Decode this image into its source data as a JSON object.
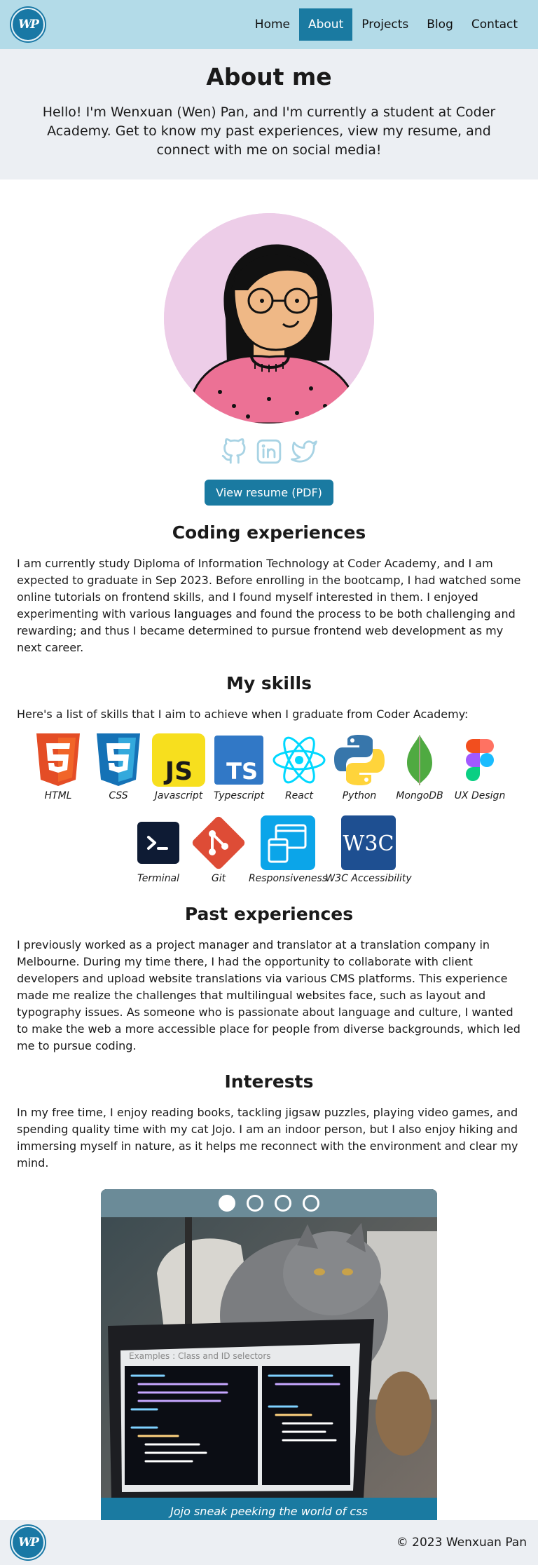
{
  "nav": {
    "logo_text": "WP",
    "links": [
      "Home",
      "About",
      "Projects",
      "Blog",
      "Contact"
    ],
    "active": "About"
  },
  "hero": {
    "title": "About me",
    "intro": "Hello! I'm Wenxuan (Wen) Pan, and I'm currently a student at Coder Academy. Get to know my past experiences, view my resume, and connect with me on social media!"
  },
  "socials": [
    "github-icon",
    "linkedin-icon",
    "twitter-icon"
  ],
  "resume_button": "View resume (PDF)",
  "coding": {
    "heading": "Coding experiences",
    "text": "I am currently study Diploma of Information Technology at Coder Academy, and I am expected to graduate in Sep 2023. Before enrolling in the bootcamp, I had watched some online tutorials on frontend skills, and I found myself interested in them. I enjoyed experimenting with various languages and found the process to be both challenging and rewarding; and thus I became determined to pursue frontend web development as my next career."
  },
  "skills": {
    "heading": "My skills",
    "intro": "Here's a list of skills that I aim to achieve when I graduate from Coder Academy:",
    "row1": [
      "HTML",
      "CSS",
      "Javascript",
      "Typescript",
      "React",
      "Python",
      "MongoDB",
      "UX Design"
    ],
    "row2": [
      "Terminal",
      "Git",
      "Responsiveness",
      "W3C Accessibility"
    ]
  },
  "past": {
    "heading": "Past experiences",
    "text": "I previously worked as a project manager and translator at a translation company in Melbourne. During my time there, I had the opportunity to collaborate with client developers and upload website translations via various CMS platforms. This experience made me realize the challenges that multilingual websites face, such as layout and typography issues. As someone who is passionate about language and culture, I wanted to make the web a more accessible place for people from diverse backgrounds, which led me to pursue coding."
  },
  "interests": {
    "heading": "Interests",
    "text": "In my free time, I enjoy reading books, tackling jigsaw puzzles, playing video games, and spending quality time with my cat Jojo. I am an indoor person, but I also enjoy hiking and immersing myself in nature, as it helps me reconnect with the environment and clear my mind."
  },
  "carousel": {
    "slides": 4,
    "active_slide": 1,
    "caption": "Jojo sneak peeking the world of css",
    "screen_title": "Examples : Class and ID selectors"
  },
  "footer": {
    "logo_text": "WP",
    "copyright": "© 2023 Wenxuan Pan"
  },
  "colors": {
    "nav_bg": "#b3dbe8",
    "accent": "#1a7aa1",
    "hero_bg": "#eceff3",
    "avatar_bg": "#edcde8"
  }
}
